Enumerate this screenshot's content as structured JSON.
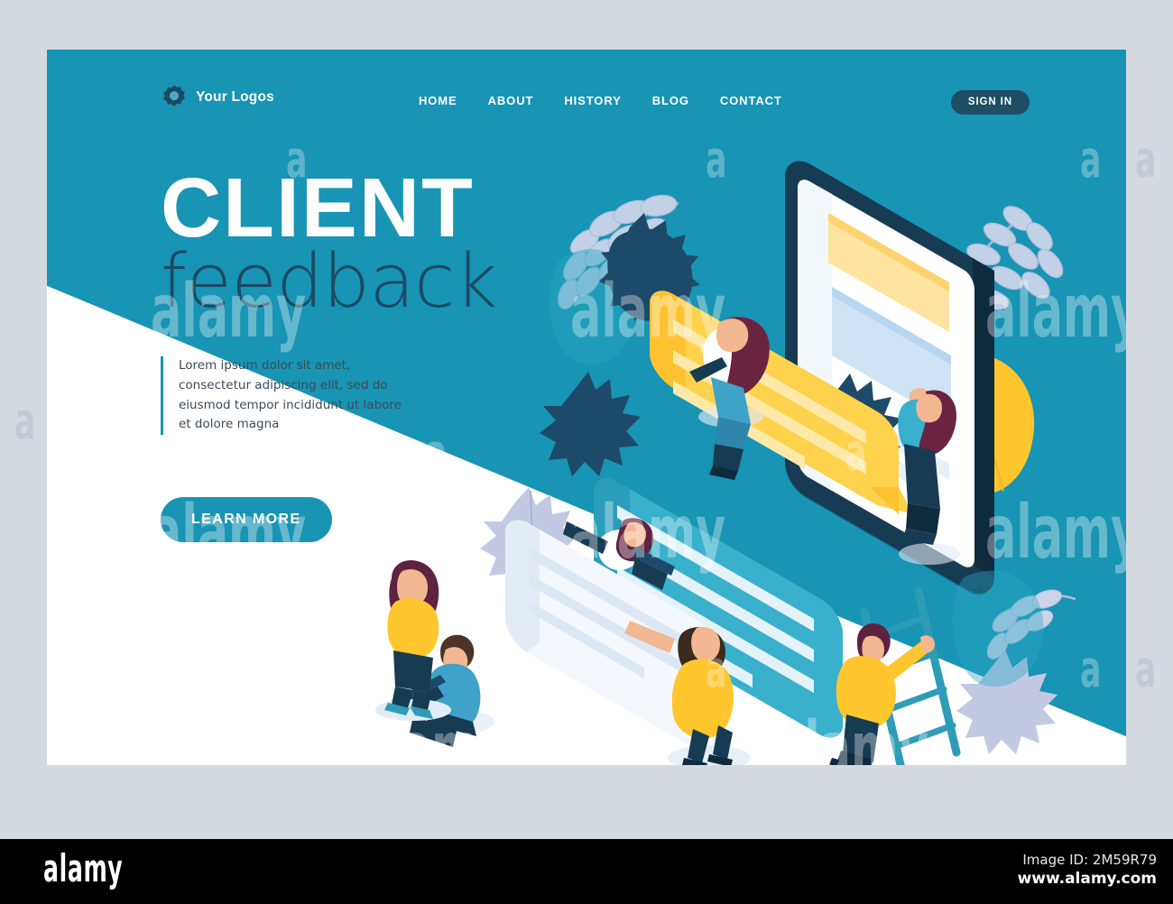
{
  "theme": {
    "teal": "#1894b4",
    "navy": "#1b4a63",
    "dark_navy": "#1d3c52",
    "yellow": "#ffc82e",
    "light_blue": "#cfe4f4",
    "page_bg": "#d5dae1",
    "white": "#ffffff"
  },
  "header": {
    "brand_name": "Your Logos",
    "logo_icon": "gear-icon",
    "nav": [
      {
        "label": "HOME"
      },
      {
        "label": "ABOUT"
      },
      {
        "label": "HISTORY"
      },
      {
        "label": "BLOG"
      },
      {
        "label": "CONTACT"
      }
    ],
    "signin_label": "SIGN IN"
  },
  "hero": {
    "title": "CLIENT",
    "subtitle": "feedback",
    "paragraph": "Lorem ipsum dolor sit amet, consectetur adipiscing elit, sed do eiusmod tempor incididunt ut labore et dolore magna",
    "cta_label": "LEARN MORE"
  },
  "illustration": {
    "name": "isometric-client-feedback-illustration",
    "elements": [
      "smartphone-device",
      "speech-bubble",
      "content-cards",
      "foliage-leaves",
      "ladder",
      "character-woman-sitting-on-bubble",
      "character-woman-lying-with-laptop",
      "character-woman-pointing-at-screen",
      "character-man-sitting-with-laptop",
      "character-woman-pushing-card",
      "character-man-on-ladder",
      "character-woman-standing"
    ]
  },
  "watermarks": {
    "word": "alamy",
    "letter": "a"
  },
  "footer": {
    "logo_text": "alamy",
    "image_id": "Image ID: 2M59R79",
    "url": "www.alamy.com"
  }
}
